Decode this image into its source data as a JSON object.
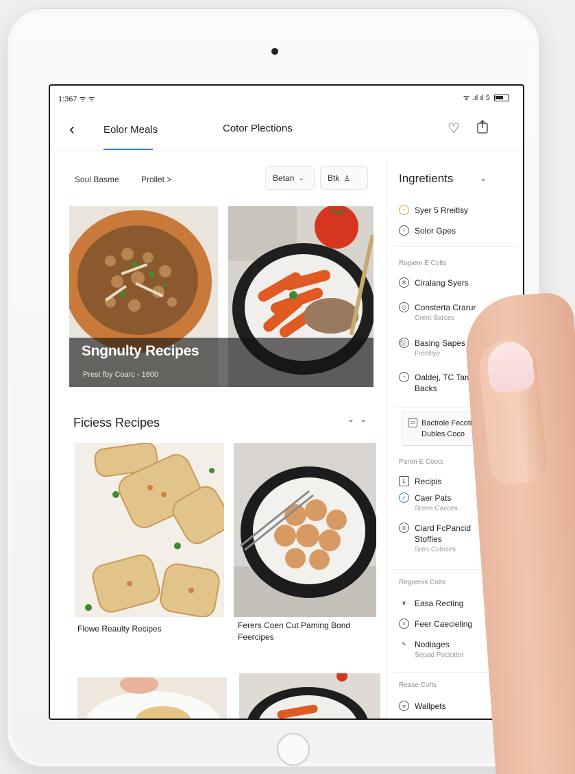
{
  "status_bar": {
    "time": "1:367 ᯤ ᯤ",
    "signal": "ᯤ .ıl ıl 5"
  },
  "header": {
    "tab_primary": "Eolor Meals",
    "tab_secondary": "Cotor Plections"
  },
  "filters": {
    "sort_label": "Soul Basme",
    "product_link": "Prollet >",
    "pill_1_label": "Betan",
    "pill_2_label": "Btk"
  },
  "hero": {
    "title": "Sngnulty Recipes",
    "subtitle": "Prest fby Coarc - 1600"
  },
  "section": {
    "title": "Ficiess Recipes"
  },
  "cards": [
    {
      "label": "Flowe Reaulty Recipes"
    },
    {
      "label": "Ferers Coen Cut Paming Bond Feercipes"
    }
  ],
  "sidebar": {
    "title": "Ingretients",
    "items_top": [
      {
        "label": "Syer 5 Rreitlsy",
        "icon": "sun-icon"
      },
      {
        "label": "Solor Gpes",
        "icon": "info-icon"
      }
    ],
    "heading_1": "Rogiem E Colts",
    "items_mid": [
      {
        "label": "Ciralang Syers",
        "sub": "",
        "icon": "gear-icon"
      },
      {
        "label": "Consterta Crarur",
        "sub": "Crent Sarces",
        "icon": "clock-icon"
      },
      {
        "label": "Basing Sapes",
        "sub": "Freciliye",
        "icon": "slash-icon"
      },
      {
        "label": "Oaldej, TC Tam",
        "sub": "Backs",
        "icon": "gauge-icon"
      }
    ],
    "boxed_item": {
      "line1": "Bactrole Fecotiel",
      "line2": "Dubles Coco"
    },
    "heading_2": "Paron E Coots",
    "items_lower": [
      {
        "label": "Recipis",
        "sub": "",
        "icon": "ld-icon"
      },
      {
        "label": "Caer Pats",
        "sub": "Sreee Cacces",
        "icon": "check-icon"
      },
      {
        "label": "Ciard FcPancid Stoffies",
        "sub": "Sren Cobcies",
        "icon": "target-icon"
      }
    ],
    "heading_3": "Regoenis Colts",
    "items_bottom": [
      {
        "label": "Easa Recting",
        "sub": "",
        "icon": "leaf-icon"
      },
      {
        "label": "Feer Caecieling",
        "sub": "",
        "icon": "drop-icon"
      },
      {
        "label": "Nodiages",
        "sub": "Sepad Poctottor",
        "icon": "pen-icon"
      }
    ],
    "heading_4": "Rease Cofts",
    "items_last": [
      {
        "label": "Wallpets",
        "sub": "",
        "icon": "pin-icon"
      }
    ]
  }
}
